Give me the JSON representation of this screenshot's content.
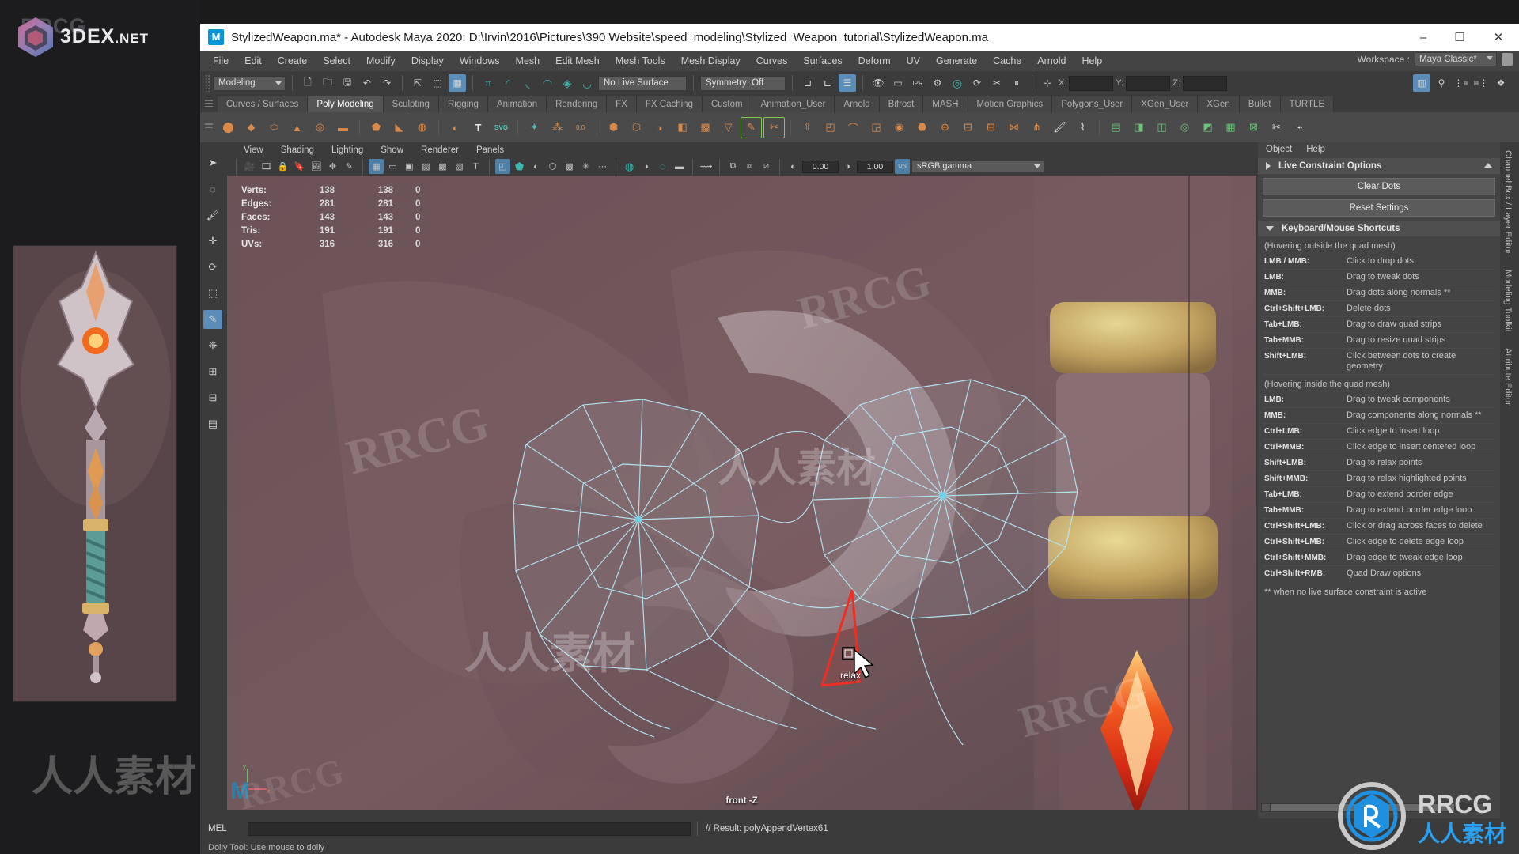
{
  "brand": {
    "left_logo_text": "3DEX",
    "left_logo_suffix": ".NET",
    "ghost_text": "RRCG",
    "corner_logo_text": "RRCG",
    "corner_logo_cn": "人人素材"
  },
  "window": {
    "title": "StylizedWeapon.ma* - Autodesk Maya 2020: D:\\Irvin\\2016\\Pictures\\390 Website\\speed_modeling\\Stylized_Weapon_tutorial\\StylizedWeapon.ma",
    "app_icon": "maya-icon",
    "minimize": "–",
    "maximize": "☐",
    "close": "✕"
  },
  "menubar": {
    "items": [
      "File",
      "Edit",
      "Create",
      "Select",
      "Modify",
      "Display",
      "Windows",
      "Mesh",
      "Edit Mesh",
      "Mesh Tools",
      "Mesh Display",
      "Curves",
      "Surfaces",
      "Deform",
      "UV",
      "Generate",
      "Cache",
      "Arnold",
      "Help"
    ],
    "workspace_label": "Workspace :",
    "workspace_value": "Maya Classic*"
  },
  "statusline": {
    "menuset": "Modeling",
    "live_surface": "No Live Surface",
    "symmetry": "Symmetry: Off",
    "coord_x_label": "X:",
    "coord_y_label": "Y:",
    "coord_z_label": "Z:",
    "coord_x_value": "",
    "coord_y_value": "",
    "coord_z_value": "",
    "icons": [
      "new-file-icon",
      "open-file-icon",
      "save-file-icon",
      "undo-icon",
      "redo-icon",
      "select-hierarchy-icon",
      "select-object-icon",
      "select-component-icon",
      "snap-grid-icon",
      "snap-curve-icon",
      "snap-point-icon",
      "snap-projected-icon",
      "snap-view-plane-icon",
      "make-live-icon",
      "render-current-frame-icon",
      "render-sequence-icon",
      "ipr-render-icon",
      "render-settings-icon",
      "hypershade-icon",
      "render-view-icon",
      "rendering-flags-icon",
      "pause-render-icon",
      "editor-toggle-icon",
      "show-manipulator-icon",
      "channel-box-icon",
      "attribute-editor-icon",
      "tool-settings-icon",
      "layer-editor-icon"
    ]
  },
  "shelf": {
    "tabs": [
      "Curves / Surfaces",
      "Poly Modeling",
      "Sculpting",
      "Rigging",
      "Animation",
      "Rendering",
      "FX",
      "FX Caching",
      "Custom",
      "Animation_User",
      "Arnold",
      "Bifrost",
      "MASH",
      "Motion Graphics",
      "Polygons_User",
      "XGen_User",
      "XGen",
      "Bullet",
      "TURTLE"
    ],
    "active_tab": "Poly Modeling"
  },
  "toolbox": {
    "items": [
      "select-tool",
      "lasso-select-tool",
      "paint-select-tool",
      "move-tool",
      "rotate-tool",
      "scale-tool",
      "universal-manip-tool",
      "last-tool",
      "quad-draw-tool",
      "multi-cut-tool",
      "snap-together-tool",
      "layout-tool-1",
      "layout-tool-2"
    ]
  },
  "viewport": {
    "menu": [
      "View",
      "Shading",
      "Lighting",
      "Show",
      "Renderer",
      "Panels"
    ],
    "exposure_value": "0.00",
    "gamma_value": "1.00",
    "color_management": "sRGB gamma",
    "view_label": "front -Z",
    "tool_hint": "relax",
    "heads_up": {
      "rows": [
        {
          "label": "Verts:",
          "a": "138",
          "b": "138",
          "c": "0"
        },
        {
          "label": "Edges:",
          "a": "281",
          "b": "281",
          "c": "0"
        },
        {
          "label": "Faces:",
          "a": "143",
          "b": "143",
          "c": "0"
        },
        {
          "label": "Tris:",
          "a": "191",
          "b": "191",
          "c": "0"
        },
        {
          "label": "UVs:",
          "a": "316",
          "b": "316",
          "c": "0"
        }
      ]
    }
  },
  "right_panel": {
    "menu": [
      "Object",
      "Help"
    ],
    "section_live_constraint": "Live Constraint Options",
    "button_clear_dots": "Clear Dots",
    "button_reset_settings": "Reset Settings",
    "section_shortcuts": "Keyboard/Mouse Shortcuts",
    "note_outside": "(Hovering outside the quad mesh)",
    "shortcuts_outside": [
      {
        "key": "LMB / MMB:",
        "action": "Click to drop dots"
      },
      {
        "key": "LMB:",
        "action": "Drag to tweak dots"
      },
      {
        "key": "MMB:",
        "action": "Drag dots along normals **"
      },
      {
        "key": "Ctrl+Shift+LMB:",
        "action": "Delete dots"
      },
      {
        "key": "Tab+LMB:",
        "action": "Drag to draw quad strips"
      },
      {
        "key": "Tab+MMB:",
        "action": "Drag to resize quad strips"
      },
      {
        "key": "Shift+LMB:",
        "action": "Click between dots to create geometry"
      }
    ],
    "note_inside": "(Hovering inside the quad mesh)",
    "shortcuts_inside": [
      {
        "key": "LMB:",
        "action": "Drag to tweak components"
      },
      {
        "key": "MMB:",
        "action": "Drag components along normals **"
      },
      {
        "key": "Ctrl+LMB:",
        "action": "Click edge to insert loop"
      },
      {
        "key": "Ctrl+MMB:",
        "action": "Click edge to insert centered loop"
      },
      {
        "key": "Shift+LMB:",
        "action": "Drag to relax points"
      },
      {
        "key": "Shift+MMB:",
        "action": "Drag to relax highlighted points"
      },
      {
        "key": "Tab+LMB:",
        "action": "Drag to extend border edge"
      },
      {
        "key": "Tab+MMB:",
        "action": "Drag to extend border edge loop"
      },
      {
        "key": "Ctrl+Shift+LMB:",
        "action": "Click or drag across faces to delete"
      },
      {
        "key": "Ctrl+Shift+LMB:",
        "action": "Click edge to delete edge loop"
      },
      {
        "key": "Ctrl+Shift+MMB:",
        "action": "Drag edge to tweak edge loop"
      },
      {
        "key": "Ctrl+Shift+RMB:",
        "action": "Quad Draw options"
      }
    ],
    "footnote": "** when no live surface constraint is active"
  },
  "vertical_tabs": [
    "Channel Box / Layer Editor",
    "Modeling Toolkit",
    "Attribute Editor"
  ],
  "bottom": {
    "mel_label": "MEL",
    "mel_input_value": "",
    "result_text": "// Result: polyAppendVertex61",
    "help_text": "Dolly Tool: Use mouse to dolly"
  },
  "watermarks": {
    "text_latin": "RRCG",
    "text_cn": "人人素材"
  },
  "colors": {
    "accent_blue": "#5b8db8",
    "teal": "#3fb6ad",
    "mesh_wire": "#9fe4f5",
    "highlight_red": "#e8312a",
    "panel_bg": "#444444",
    "dark_bg": "#3b3b3b",
    "title_bg": "#ffffff"
  }
}
